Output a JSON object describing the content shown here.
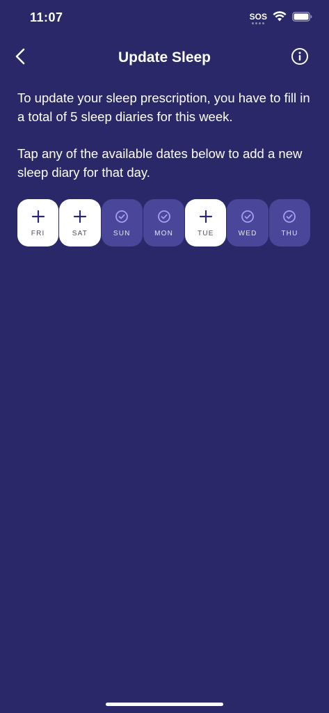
{
  "status_bar": {
    "time": "11:07",
    "sos": "SOS"
  },
  "nav": {
    "title": "Update Sleep",
    "back_icon": "chevron-left-icon",
    "info_icon": "info-circle-icon"
  },
  "content": {
    "paragraph_1": "To update your sleep prescription, you have to fill in a total of 5 sleep diaries for this week.",
    "paragraph_2": "Tap any of the available dates below to add a new sleep diary for that day."
  },
  "days": [
    {
      "label": "FRI",
      "state": "available",
      "icon": "plus-icon"
    },
    {
      "label": "SAT",
      "state": "available",
      "icon": "plus-icon"
    },
    {
      "label": "SUN",
      "state": "completed",
      "icon": "check-circle-icon"
    },
    {
      "label": "MON",
      "state": "completed",
      "icon": "check-circle-icon"
    },
    {
      "label": "TUE",
      "state": "available",
      "icon": "plus-icon"
    },
    {
      "label": "WED",
      "state": "completed",
      "icon": "check-circle-icon"
    },
    {
      "label": "THU",
      "state": "completed",
      "icon": "check-circle-icon"
    }
  ],
  "colors": {
    "background": "#2b2869",
    "completed_card": "#4a469a",
    "available_card": "#ffffff",
    "check_accent": "#a89ef0"
  }
}
